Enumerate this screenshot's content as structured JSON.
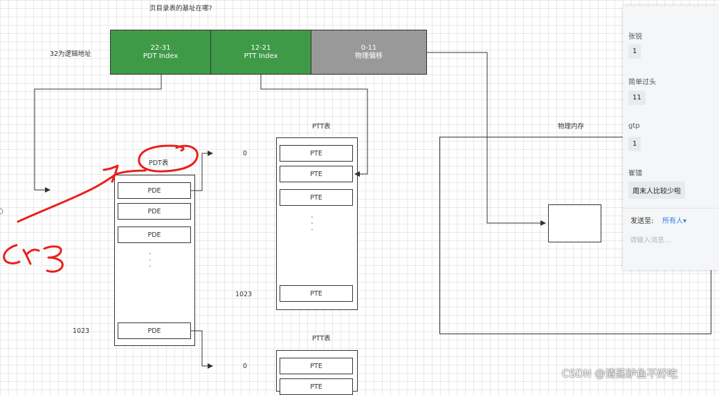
{
  "question": "页目录表的基址在哪?",
  "address_note": "32为逻辑地址",
  "address_fields": [
    {
      "bits": "22-31",
      "name": "PDT Index"
    },
    {
      "bits": "12-21",
      "name": "PTT Index"
    },
    {
      "bits": "0-11",
      "name": "物理偏移"
    }
  ],
  "pdt": {
    "label": "PDT表",
    "entries": [
      "PDE",
      "PDE",
      "PDE",
      "PDE"
    ],
    "last_index": "1023",
    "dots": "."
  },
  "ptt_top": {
    "title": "PTT表",
    "first_index": "0",
    "entries": [
      "PTE",
      "PTE",
      "PTE",
      "PTE"
    ],
    "last_index": "1023",
    "dots": "."
  },
  "ptt_bottom": {
    "title": "PTT表",
    "first_index": "0",
    "entries": [
      "PTE",
      "PTE"
    ]
  },
  "memory": {
    "title": "物理内存"
  },
  "chat": {
    "messages": [
      {
        "user": "张锐",
        "text": "1"
      },
      {
        "user": "简单过头",
        "text": "11"
      },
      {
        "user": "gtp",
        "text": "1"
      },
      {
        "user": "崔镭",
        "text": "周末人比较少啦"
      }
    ],
    "send_to_label": "发送至:",
    "send_to_value": "所有人▾",
    "input_placeholder": "请输入消息..."
  },
  "watermark": "CSDN @清蒸鲈鱼不好吃",
  "annotation_colors": {
    "ink": "#e8201a",
    "pdt_green": "#3f9a48",
    "offset_gray": "#999999"
  }
}
